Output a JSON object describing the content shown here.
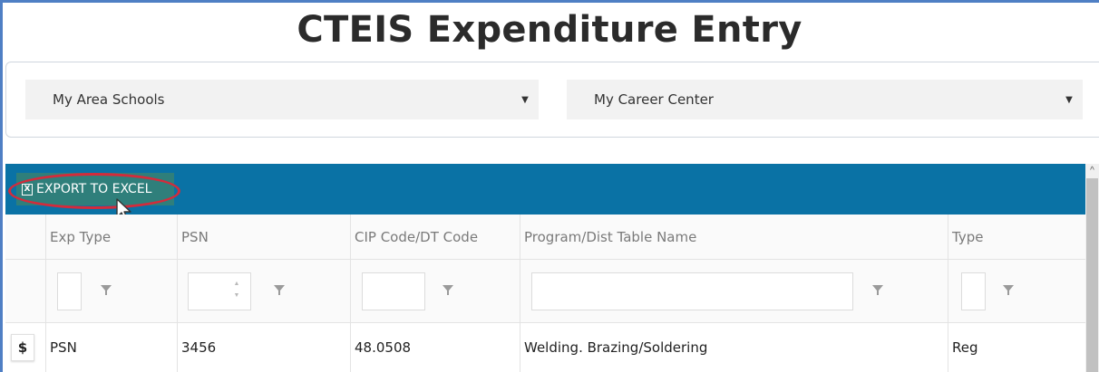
{
  "page": {
    "title": "CTEIS Expenditure Entry"
  },
  "filters": {
    "area_schools": {
      "value": "My Area Schools",
      "caret": "▼"
    },
    "career_center": {
      "value": "My Career Center",
      "caret": "▼"
    }
  },
  "toolbar": {
    "export_label": "EXPORT TO EXCEL",
    "export_icon": "excel-icon"
  },
  "grid": {
    "columns": [
      "Exp Type",
      "PSN",
      "CIP Code/DT Code",
      "Program/Dist Table Name",
      "Type"
    ],
    "rows": [
      {
        "action": "$",
        "exp_type": "PSN",
        "psn": "3456",
        "cip_code": "48.0508",
        "program_name": "Welding. Brazing/Soldering",
        "type": "Reg"
      }
    ]
  },
  "colors": {
    "toolbar": "#0a72a5",
    "export_button": "#2f7f7b",
    "highlight": "#d42b3b"
  }
}
